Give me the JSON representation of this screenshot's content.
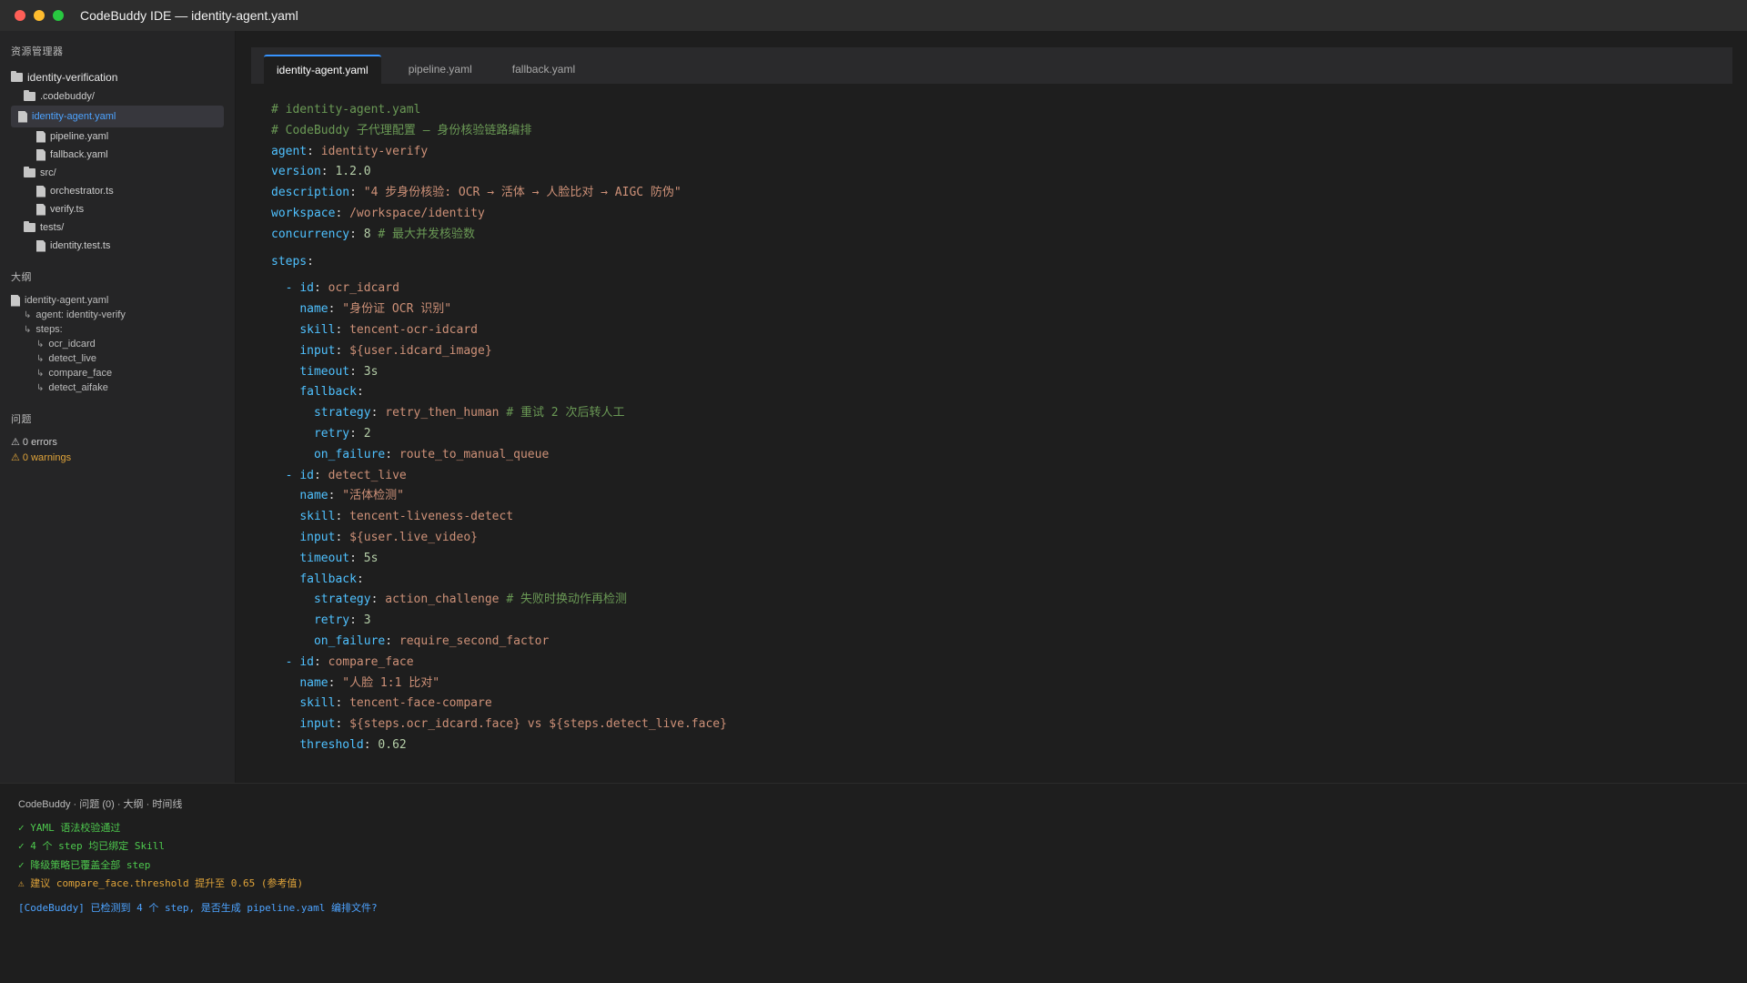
{
  "window": {
    "title": "CodeBuddy IDE — identity-agent.yaml"
  },
  "explorer": {
    "heading": "资源管理器",
    "root": "identity-verification",
    "items": [
      {
        "label": ".codebuddy/",
        "type": "folder"
      },
      {
        "label": "identity-agent.yaml",
        "type": "file",
        "selected": true
      },
      {
        "label": "pipeline.yaml",
        "type": "file"
      },
      {
        "label": "fallback.yaml",
        "type": "file"
      },
      {
        "label": "src/",
        "type": "folder"
      },
      {
        "label": "orchestrator.ts",
        "type": "file"
      },
      {
        "label": "verify.ts",
        "type": "file"
      },
      {
        "label": "tests/",
        "type": "folder"
      },
      {
        "label": "identity.test.ts",
        "type": "file"
      }
    ]
  },
  "outline": {
    "heading": "大纲",
    "file": "identity-agent.yaml",
    "items": [
      "agent: identity-verify",
      "steps:",
      "ocr_idcard",
      "detect_live",
      "compare_face",
      "detect_aifake"
    ]
  },
  "problems": {
    "heading": "问题",
    "errors": "⚠ 0 errors",
    "warnings": "⚠ 0 warnings"
  },
  "tabs": [
    "identity-agent.yaml",
    "pipeline.yaml",
    "fallback.yaml"
  ],
  "code": {
    "l1": "# identity-agent.yaml",
    "l2": "# CodeBuddy 子代理配置 — 身份核验链路编排",
    "agent_key": "agent",
    "agent_val": "identity-verify",
    "version_key": "version",
    "version_val": "1.2.0",
    "desc_key": "description",
    "desc_val": "\"4 步身份核验: OCR → 活体 → 人脸比对 → AIGC 防伪\"",
    "ws_key": "workspace",
    "ws_val": "/workspace/identity",
    "conc_key": "concurrency",
    "conc_val": "8",
    "conc_comment": "# 最大并发核验数",
    "steps_key": "steps",
    "s1_id": "ocr_idcard",
    "s1_name": "\"身份证 OCR 识别\"",
    "s1_skill": "tencent-ocr-idcard",
    "s1_input": "${user.idcard_image}",
    "s1_timeout": "3s",
    "s1_strategy": "retry_then_human",
    "s1_strategy_comment": "# 重试 2 次后转人工",
    "s1_retry": "2",
    "s1_onfail": "route_to_manual_queue",
    "s2_id": "detect_live",
    "s2_name": "\"活体检测\"",
    "s2_skill": "tencent-liveness-detect",
    "s2_input": "${user.live_video}",
    "s2_timeout": "5s",
    "s2_strategy": "action_challenge",
    "s2_strategy_comment": "# 失败时换动作再检测",
    "s2_retry": "3",
    "s2_onfail": "require_second_factor",
    "s3_id": "compare_face",
    "s3_name": "\"人脸 1:1 比对\"",
    "s3_skill": "tencent-face-compare",
    "s3_input": "${steps.ocr_idcard.face} vs ${steps.detect_live.face}",
    "s3_threshold": "0.62",
    "id_key": "id",
    "name_key": "name",
    "skill_key": "skill",
    "input_key": "input",
    "timeout_key": "timeout",
    "fallback_key": "fallback",
    "strategy_key": "strategy",
    "retry_key": "retry",
    "onfail_key": "on_failure",
    "threshold_key": "threshold"
  },
  "panel": {
    "heading": "CodeBuddy · 问题 (0) · 大纲 · 时间线",
    "lines": [
      "✓ YAML 语法校验通过",
      "✓ 4 个 step 均已绑定 Skill",
      "✓ 降级策略已覆盖全部 step",
      "⚠ 建议 compare_face.threshold 提升至 0.65 (参考值)",
      "[CodeBuddy] 已检测到 4 个 step, 是否生成 pipeline.yaml 编排文件?"
    ]
  },
  "colors": {
    "accent": "#3794ff",
    "ok": "#4ec94e",
    "warn": "#e0a43a"
  }
}
